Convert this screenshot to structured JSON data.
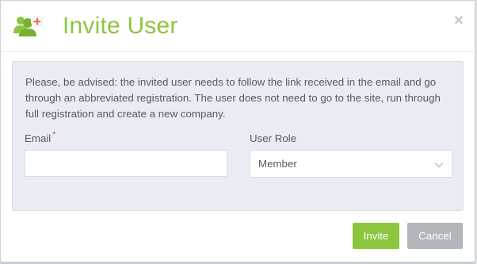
{
  "dialog": {
    "title": "Invite User",
    "close_label": "×",
    "icon": "users-add-icon"
  },
  "notice": {
    "text": "Please, be advised: the invited user needs to follow the link received in the email and go through an abbreviated registration. The user does not need to go to the site, run through full registration and create a new company."
  },
  "form": {
    "email": {
      "label": "Email",
      "required_marker": "*",
      "value": "",
      "placeholder": ""
    },
    "user_role": {
      "label": "User Role",
      "selected": "Member"
    }
  },
  "buttons": {
    "invite_label": "Invite",
    "cancel_label": "Cancel"
  },
  "colors": {
    "accent_green": "#8cc63e",
    "cancel_gray": "#b3b7bb",
    "panel_bg": "#e9edf3",
    "required_red": "#e05050"
  }
}
